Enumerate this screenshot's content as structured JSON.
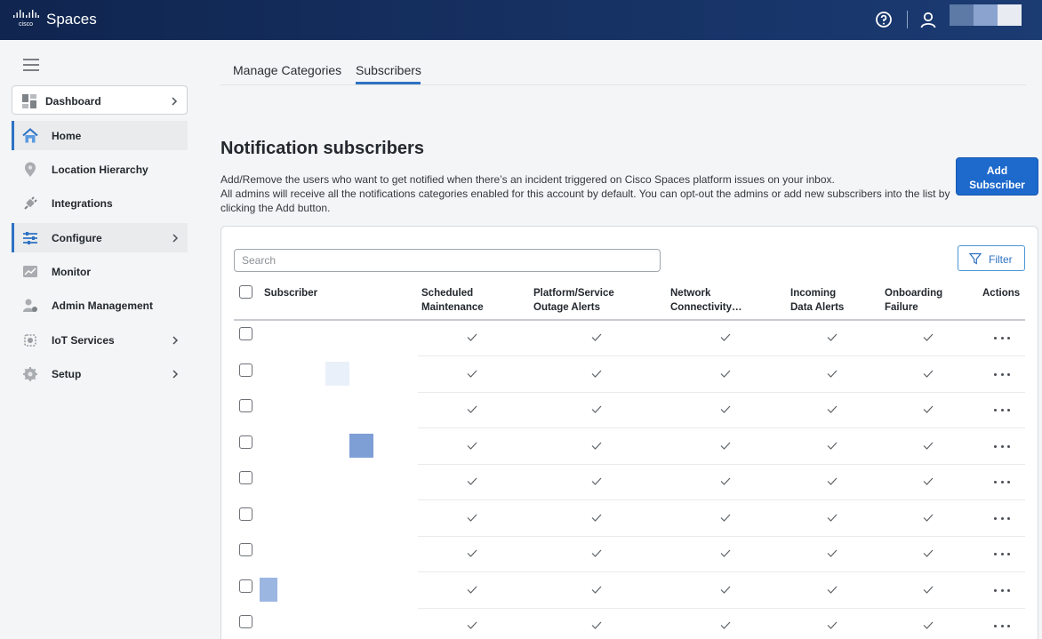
{
  "app": {
    "brand": "Spaces",
    "logo_label": "cisco",
    "avatar_colors": [
      "#5d7aa6",
      "#8aa4cf",
      "#e8ecf2"
    ]
  },
  "sidebar": {
    "items": [
      {
        "label": "Dashboard",
        "icon": "dashboard-icon",
        "chevron": true
      },
      {
        "label": "Home",
        "icon": "home-icon",
        "chevron": false,
        "active": true
      },
      {
        "label": "Location Hierarchy",
        "icon": "location-pin-icon",
        "chevron": false
      },
      {
        "label": "Integrations",
        "icon": "plug-icon",
        "chevron": false
      },
      {
        "label": "Configure",
        "icon": "sliders-icon",
        "chevron": true,
        "active": true
      },
      {
        "label": "Monitor",
        "icon": "monitor-chart-icon",
        "chevron": false
      },
      {
        "label": "Admin Management",
        "icon": "admin-users-icon",
        "chevron": false
      },
      {
        "label": "IoT Services",
        "icon": "iot-chip-icon",
        "chevron": true
      },
      {
        "label": "Setup",
        "icon": "gear-icon",
        "chevron": true
      }
    ]
  },
  "tabs": [
    {
      "label": "Manage Categories",
      "selected": false
    },
    {
      "label": "Subscribers",
      "selected": true
    }
  ],
  "main": {
    "title": "Notification subscribers",
    "desc_line1": "Add/Remove the users who want to get notified when there’s an incident triggered on Cisco Spaces platform issues on your inbox.",
    "desc_line2": "All admins will receive all the notifications categories enabled for this account by default. You can opt-out the admins or add new subscribers into the list by clicking the Add button.",
    "add_button_line1": "Add",
    "add_button_line2": "Subscriber",
    "search_placeholder": "Search",
    "filter_label": "Filter",
    "accent_color": "#1d69cc"
  },
  "table": {
    "columns": [
      {
        "l1": "Subscriber",
        "l2": ""
      },
      {
        "l1": "Scheduled",
        "l2": "Maintenance"
      },
      {
        "l1": "Platform/Service",
        "l2": "Outage Alerts"
      },
      {
        "l1": "Network",
        "l2": "Connectivity…"
      },
      {
        "l1": "Incoming",
        "l2": "Data Alerts"
      },
      {
        "l1": "Onboarding",
        "l2": "Failure"
      },
      {
        "l1": "Actions",
        "l2": ""
      }
    ],
    "rows": [
      {
        "subscriber": "",
        "checks": [
          true,
          true,
          true,
          true,
          true
        ]
      },
      {
        "subscriber": "",
        "checks": [
          true,
          true,
          true,
          true,
          true
        ]
      },
      {
        "subscriber": "",
        "checks": [
          true,
          true,
          true,
          true,
          true
        ]
      },
      {
        "subscriber": "",
        "checks": [
          true,
          true,
          true,
          true,
          true
        ]
      },
      {
        "subscriber": "",
        "checks": [
          true,
          true,
          true,
          true,
          true
        ]
      },
      {
        "subscriber": "",
        "checks": [
          true,
          true,
          true,
          true,
          true
        ]
      },
      {
        "subscriber": "",
        "checks": [
          true,
          true,
          true,
          true,
          true
        ]
      },
      {
        "subscriber": "",
        "checks": [
          true,
          true,
          true,
          true,
          true
        ]
      },
      {
        "subscriber": "",
        "checks": [
          true,
          true,
          true,
          true,
          true
        ]
      }
    ]
  }
}
